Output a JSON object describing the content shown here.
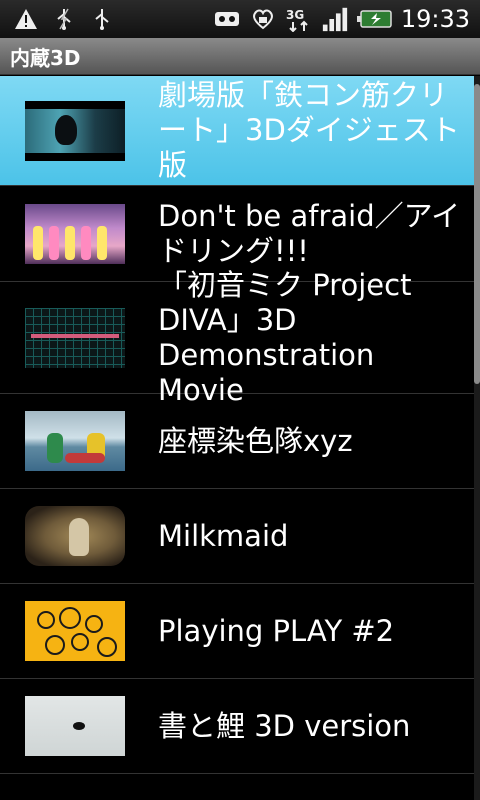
{
  "statusbar": {
    "time": "19:33",
    "network": "3G",
    "left_icons": [
      "alert-icon",
      "usb-debug-icon",
      "usb-icon"
    ],
    "right_icons": [
      "voicemail-icon",
      "heart-app-icon",
      "network-3g-icon",
      "signal-icon",
      "battery-icon"
    ]
  },
  "app": {
    "title": "内蔵3D"
  },
  "list": {
    "selected_index": 0,
    "items": [
      {
        "label": "劇場版「鉄コン筋クリート」3Dダイジェスト版",
        "thumb": "t1"
      },
      {
        "label": "Don't be afraid／アイドリング!!!",
        "thumb": "t2"
      },
      {
        "label": "「初音ミク Project DIVA」3D Demonstration Movie",
        "thumb": "t3"
      },
      {
        "label": "座標染色隊xyz",
        "thumb": "t4"
      },
      {
        "label": "Milkmaid",
        "thumb": "t5"
      },
      {
        "label": "Playing PLAY #2",
        "thumb": "t6"
      },
      {
        "label": "書と鯉 3D version",
        "thumb": "t7"
      }
    ]
  },
  "colors": {
    "selected_bg": "#4cc3e8",
    "titlebar_bg": "#6e6e6e",
    "background": "#000000"
  }
}
